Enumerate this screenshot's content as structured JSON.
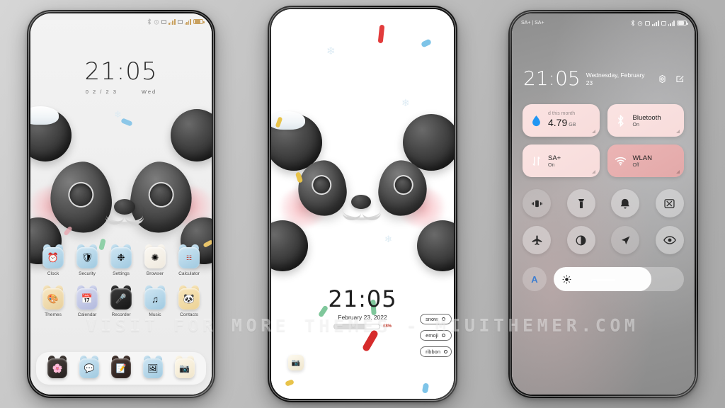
{
  "watermark": "VISIT FOR MORE THEMES - MIUITHEMER.COM",
  "theme": {
    "name": "Panda",
    "accent_pink": "#f7dcdb",
    "accent_deep_pink": "#e3a9a9",
    "page_bg": "#b8b8b8"
  },
  "phone1": {
    "label": "lock-screen",
    "statusbar": {
      "icons": [
        "bluetooth-icon",
        "alarm-icon",
        "sim-icon",
        "signal-icon",
        "sim-icon",
        "signal-icon",
        "battery-icon"
      ]
    },
    "clock": {
      "time": "21:05",
      "date": "0 2 / 2 3",
      "weekday": "Wed"
    },
    "apps_row1": [
      {
        "label": "Clock",
        "icon": "clock-icon",
        "glyph": "⏱",
        "bg": "#bcd9ea"
      },
      {
        "label": "Security",
        "icon": "shield-icon",
        "glyph": "Ὦ1",
        "bg": "#bcd9ea"
      },
      {
        "label": "Settings",
        "icon": "settings-icon",
        "glyph": "⚙",
        "bg": "#bcd9ea"
      },
      {
        "label": "Browser",
        "icon": "browser-icon",
        "glyph": "✈",
        "bg": "#f4f1ec"
      },
      {
        "label": "Calculator",
        "icon": "calculator-icon",
        "glyph": "➗",
        "bg": "#bcd9ea"
      }
    ],
    "apps_row2": [
      {
        "label": "Themes",
        "icon": "themes-icon",
        "glyph": "Ἲ8",
        "bg": "#f0dcb0"
      },
      {
        "label": "Calendar",
        "icon": "calendar-icon",
        "glyph": "Ὄ5",
        "bg": "#c3c8e6"
      },
      {
        "label": "Recorder",
        "icon": "recorder-icon",
        "glyph": "Ἲ4",
        "bg": "#2b2b2b"
      },
      {
        "label": "Music",
        "icon": "music-icon",
        "glyph": "♫",
        "bg": "#bcd9ea"
      },
      {
        "label": "Contacts",
        "icon": "contacts-icon",
        "glyph": "ὃc",
        "bg": "#f2dfb2"
      }
    ],
    "dock": [
      {
        "label": "Gallery",
        "icon": "gallery-icon",
        "glyph": "ἳ8",
        "bg": "#3a3431"
      },
      {
        "label": "Messages",
        "icon": "messages-icon",
        "glyph": "Ὂc",
        "bg": "#bcd9ea"
      },
      {
        "label": "Notes",
        "icon": "notes-icon",
        "glyph": "Ὅd",
        "bg": "#3a2e2b"
      },
      {
        "label": "Photos",
        "icon": "photos-icon",
        "glyph": "Ὓc",
        "bg": "#bcd9ea"
      },
      {
        "label": "Camera",
        "icon": "camera-icon",
        "glyph": "὏7",
        "bg": "#f7f0df"
      }
    ]
  },
  "phone2": {
    "label": "wallpaper-preview",
    "clock": {
      "time": "21:05",
      "date": "February 23, 2022"
    },
    "progress": {
      "percent": "68%",
      "value": 68
    },
    "chips": [
      {
        "label": "snow",
        "toggle": "snow-toggle"
      },
      {
        "label": "emoji",
        "toggle": "emoji-toggle"
      },
      {
        "label": "ribbon",
        "toggle": "ribbon-toggle"
      }
    ],
    "floating_app": {
      "label": "Camera",
      "glyph": "὏7"
    }
  },
  "phone3": {
    "label": "control-center",
    "statusbar": {
      "carrier": "SA+ | SA+",
      "icons": [
        "bluetooth-icon",
        "alarm-icon",
        "sim-icon",
        "signal-icon",
        "sim-icon",
        "signal-icon",
        "battery-icon"
      ]
    },
    "header": {
      "time": "21:05",
      "date": "Wednesday, February 23",
      "settings_icon": "gear-icon",
      "edit_icon": "edit-icon"
    },
    "tiles": [
      {
        "name": "data-usage-tile",
        "type": "data",
        "top_text": "d this month",
        "value": "4.79",
        "unit": "GB",
        "icon": "water-drop-icon",
        "style": "pale"
      },
      {
        "name": "bluetooth-tile",
        "type": "toggle",
        "label": "Bluetooth",
        "state": "On",
        "icon": "bluetooth-icon",
        "style": "pale"
      },
      {
        "name": "mobile-data-tile",
        "type": "toggle",
        "label": "SA+",
        "state": "On",
        "icon": "data-arrows-icon",
        "style": "pale"
      },
      {
        "name": "wlan-tile",
        "type": "toggle",
        "label": "WLAN",
        "state": "Off",
        "icon": "wifi-icon",
        "style": "deep"
      }
    ],
    "circles_row1": [
      {
        "name": "vibrate-toggle",
        "icon": "vibrate-icon",
        "active": true
      },
      {
        "name": "flashlight-toggle",
        "icon": "flashlight-icon",
        "active": false
      },
      {
        "name": "ringer-toggle",
        "icon": "bell-icon",
        "active": false
      },
      {
        "name": "screenshot-toggle",
        "icon": "screenshot-icon",
        "active": false
      }
    ],
    "circles_row2": [
      {
        "name": "airplane-toggle",
        "icon": "airplane-icon",
        "active": false
      },
      {
        "name": "dark-mode-toggle",
        "icon": "contrast-icon",
        "active": false
      },
      {
        "name": "location-toggle",
        "icon": "location-arrow-icon",
        "active": true
      },
      {
        "name": "eye-comfort-toggle",
        "icon": "eye-icon",
        "active": false
      }
    ],
    "brightness": {
      "auto_label": "A",
      "icon": "sun-icon",
      "level": 75
    }
  }
}
